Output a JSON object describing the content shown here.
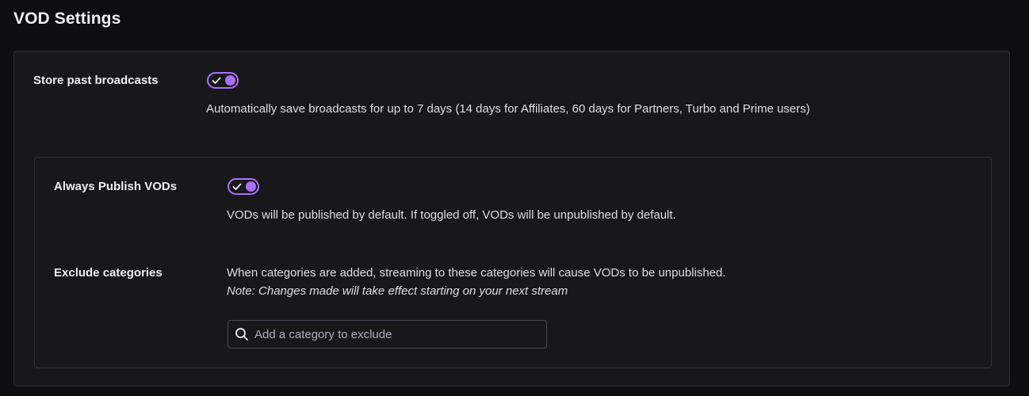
{
  "page": {
    "title": "VOD Settings"
  },
  "store_past": {
    "label": "Store past broadcasts",
    "enabled": true,
    "description": "Automatically save broadcasts for up to 7 days (14 days for Affiliates, 60 days for Partners, Turbo and Prime users)"
  },
  "always_publish": {
    "label": "Always Publish VODs",
    "enabled": true,
    "description": "VODs will be published by default. If toggled off, VODs will be unpublished by default."
  },
  "exclude_categories": {
    "label": "Exclude categories",
    "description": "When categories are added, streaming to these categories will cause VODs to be unpublished.",
    "note": "Note: Changes made will take effect starting on your next stream",
    "search_placeholder": "Add a category to exclude",
    "search_value": ""
  },
  "colors": {
    "background": "#0e0e10",
    "panel": "#18181b",
    "border": "#2f2f35",
    "accent": "#a970ff",
    "text": "#efeff1"
  },
  "icons": {
    "toggle_check": "checkmark-icon",
    "search": "search-icon"
  }
}
